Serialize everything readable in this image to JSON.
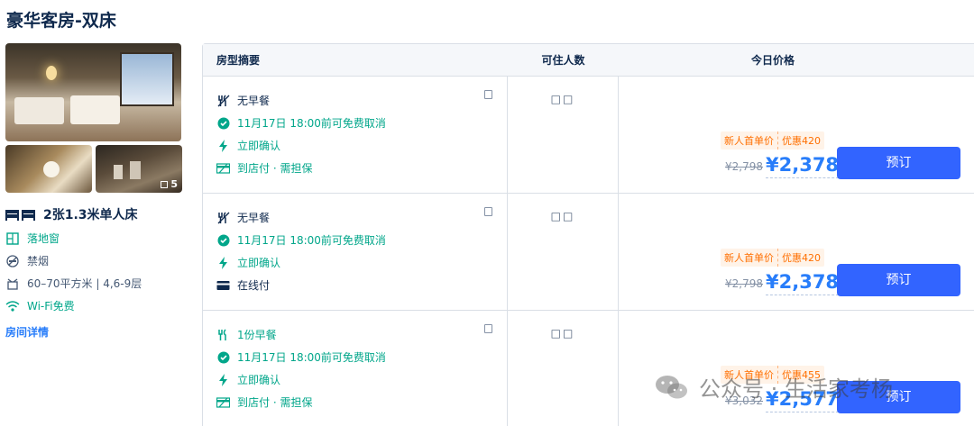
{
  "room": {
    "title": "豪华客房-双床",
    "photo_count": "5",
    "bed": "2张1.3米单人床",
    "facilities": [
      {
        "icon": "window-icon",
        "label": "落地窗"
      },
      {
        "icon": "no-smoking-icon",
        "label": "禁烟"
      },
      {
        "icon": "area-icon",
        "label": "60–70平方米 | 4,6-9层"
      },
      {
        "icon": "wifi-icon",
        "label": "Wi-Fi免费"
      }
    ],
    "detail_link": "房间详情"
  },
  "table": {
    "headers": {
      "summary": "房型摘要",
      "guests": "可住人数",
      "price": "今日价格"
    },
    "rows": [
      {
        "meal": "无早餐",
        "meal_icon": "no-breakfast-icon",
        "cancel": "11月17日 18:00前可免费取消",
        "confirm": "立即确认",
        "payment": "到店付 · 需担保",
        "payment_icon": "pay-at-hotel-icon",
        "guests": "□□",
        "promo_label": "新人首单价",
        "promo_discount": "优惠420",
        "original_price": "¥2,798",
        "price": "¥2,378",
        "book": "预订"
      },
      {
        "meal": "无早餐",
        "meal_icon": "no-breakfast-icon",
        "cancel": "11月17日 18:00前可免费取消",
        "confirm": "立即确认",
        "payment": "在线付",
        "payment_icon": "online-pay-icon",
        "guests": "□□",
        "promo_label": "新人首单价",
        "promo_discount": "优惠420",
        "original_price": "¥2,798",
        "price": "¥2,378",
        "book": "预订"
      },
      {
        "meal": "1份早餐",
        "meal_icon": "breakfast-icon",
        "cancel": "11月17日 18:00前可免费取消",
        "confirm": "立即确认",
        "payment": "到店付 · 需担保",
        "payment_icon": "pay-at-hotel-icon",
        "guests": "□□",
        "promo_label": "新人首单价",
        "promo_discount": "优惠455",
        "original_price": "¥3,032",
        "price": "¥2,577",
        "book": "预订"
      }
    ]
  },
  "watermark": "公众号 · 生活家考杨",
  "colors": {
    "accent": "#287dfa",
    "button": "#3264ff",
    "green": "#00a68a",
    "promo": "#ff6f00"
  }
}
